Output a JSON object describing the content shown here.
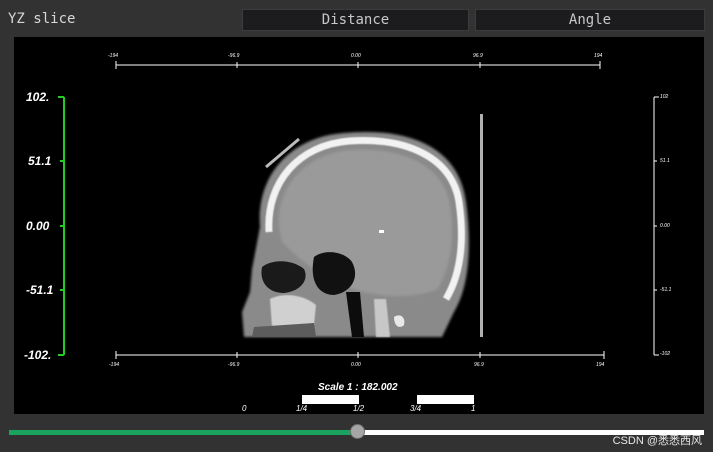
{
  "window": {
    "title": "YZ slice"
  },
  "toolbar": {
    "distance_label": "Distance",
    "angle_label": "Angle"
  },
  "viewer": {
    "left_axis_labels": [
      "102.",
      "51.1",
      "0.00",
      "-51.1",
      "-102."
    ],
    "right_axis_labels": [
      "102",
      "51.1",
      "0.00",
      "-51.1",
      "-102"
    ],
    "top_axis_labels": [
      "-194",
      "-96.9",
      "0.00",
      "96.9",
      "194"
    ],
    "bottom_axis_labels": [
      "-194",
      "-96.9",
      "0.00",
      "96.9",
      "194"
    ],
    "scale_text": "Scale 1 : 182.002",
    "scale_ticks": [
      "0",
      "1/4",
      "1/2",
      "3/4",
      "1"
    ],
    "colors": {
      "left_axis": "#22cc22",
      "frame_axes": "#ffffff"
    }
  },
  "slider": {
    "value_fraction": 0.5
  },
  "watermark": "CSDN @悉悉西风"
}
